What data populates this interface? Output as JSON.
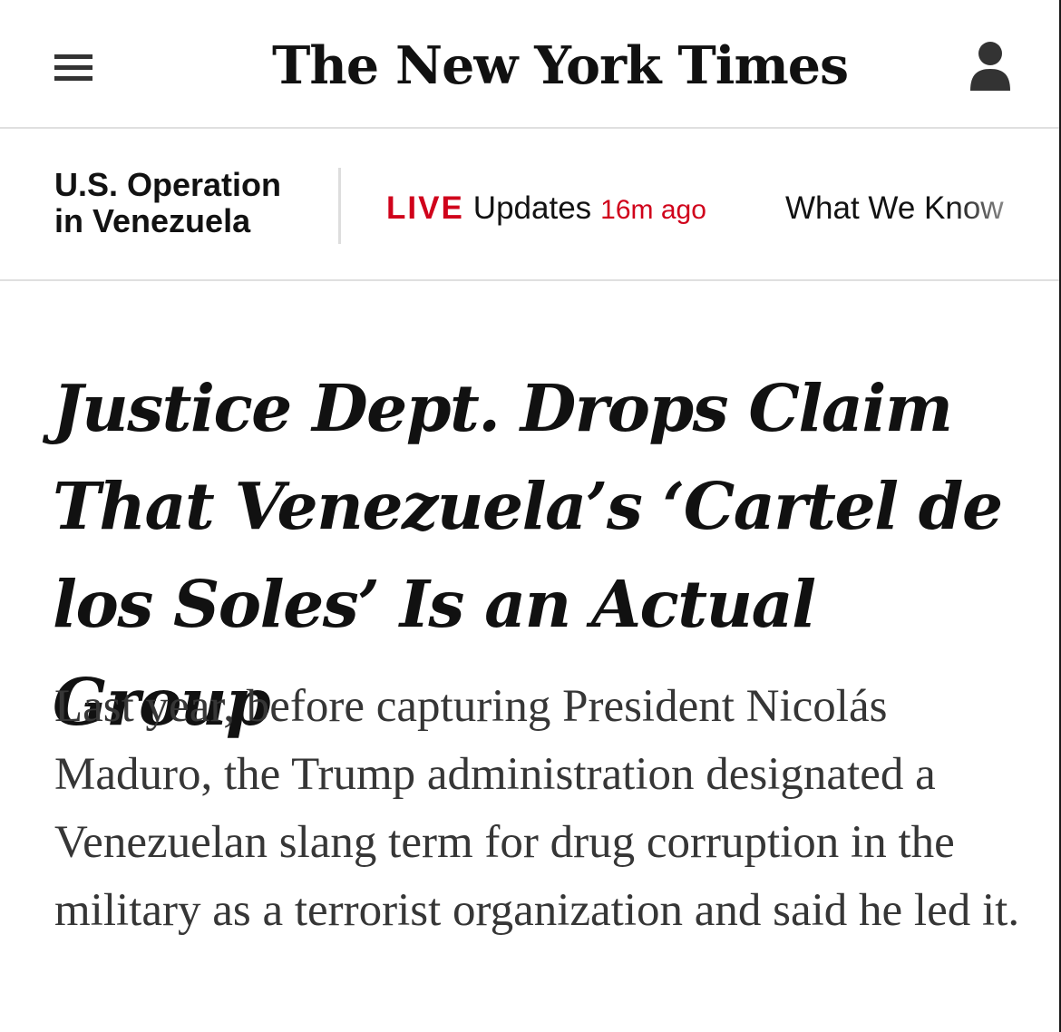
{
  "masthead": {
    "logo_text": "The New York Times",
    "menu_icon": "hamburger-menu-icon",
    "account_icon": "account-user-icon"
  },
  "section_nav": {
    "section_title_line1": "U.S. Operation",
    "section_title_line2": "in Venezuela",
    "live_label": "LIVE",
    "updates_label": "Updates",
    "updated_ago": "16m ago",
    "what_we_know": "What We Know"
  },
  "article": {
    "headline": "Justice Dept. Drops Claim That Venezuela’s ‘Cartel de los Soles’ Is an Actual Group",
    "summary": "Last year, before capturing President Nicolás Maduro, the Trump administration designated a Venezuelan slang term for drug corruption in the military as a terrorist organization and said he led it."
  },
  "colors": {
    "live_red": "#d0021b",
    "text_primary": "#121212",
    "text_summary": "#363636",
    "divider": "#dfdfdf"
  }
}
